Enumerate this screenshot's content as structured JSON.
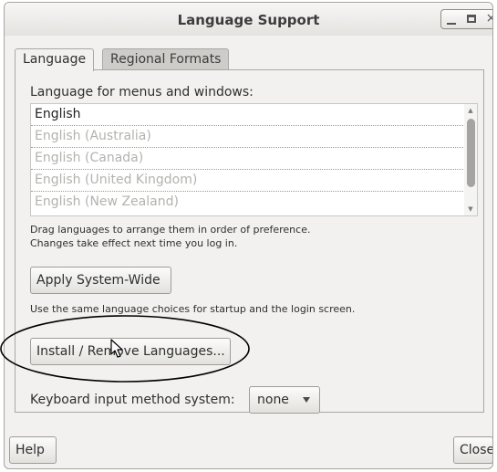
{
  "window": {
    "title": "Language Support"
  },
  "tabs": [
    {
      "label": "Language",
      "active": true
    },
    {
      "label": "Regional Formats",
      "active": false
    }
  ],
  "language": {
    "heading": "Language for menus and windows:",
    "items": [
      {
        "label": "English",
        "state": "primary"
      },
      {
        "label": "English (Australia)",
        "state": "secondary"
      },
      {
        "label": "English (Canada)",
        "state": "secondary"
      },
      {
        "label": "English (United Kingdom)",
        "state": "secondary"
      },
      {
        "label": "English (New Zealand)",
        "state": "secondary"
      }
    ],
    "hint_line1": "Drag languages to arrange them in order of preference.",
    "hint_line2": "Changes take effect next time you log in.",
    "apply_label": "Apply System-Wide",
    "apply_hint": "Use the same language choices for startup and the login screen.",
    "install_label": "Install / Remove Languages...",
    "keyboard_label": "Keyboard input method system:",
    "keyboard_value": "none"
  },
  "footer": {
    "help_label": "Help",
    "close_label": "Close"
  },
  "colors": {
    "window_bg": "#f2f1f0",
    "secondary_text": "#b2b2ae",
    "annotation": "#000000"
  }
}
